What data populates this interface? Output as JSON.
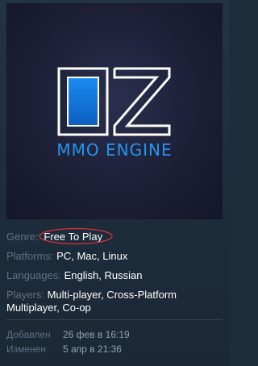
{
  "preview": {
    "logo_text": "MMO ENGINE",
    "accent_color": "#2496ee",
    "logo_icon": "oz-logo-icon"
  },
  "details": {
    "genre_label": "Genre:",
    "genre_value": "Free To Play",
    "platforms_label": "Platforms:",
    "platforms": [
      "PC",
      "Mac",
      "Linux"
    ],
    "languages_label": "Languages:",
    "languages": [
      "English",
      "Russian"
    ],
    "players_label": "Players:",
    "players": [
      "Multi-player",
      "Cross-Platform Multiplayer",
      "Co-op"
    ]
  },
  "annotation": {
    "circle_color": "#e0303a"
  },
  "dates": {
    "added_label": "Добавлен",
    "added_value": "26 фев в 16:19",
    "changed_label": "Изменен",
    "changed_value": "5 апр в 21:36"
  }
}
